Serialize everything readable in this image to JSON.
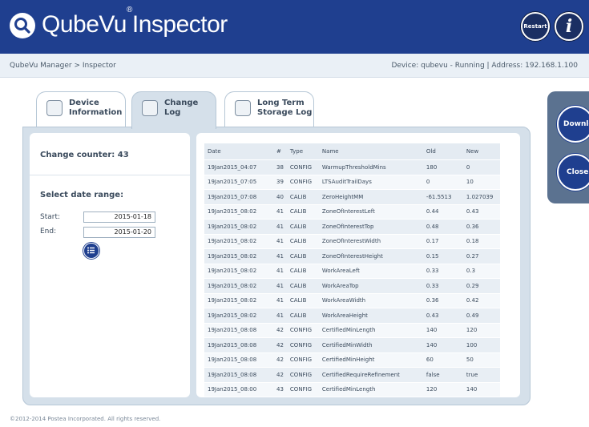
{
  "header": {
    "app_name": "QubeVu",
    "trademark": "®",
    "app_sub": "Inspector",
    "restart_label": "Restart",
    "info_label": "i"
  },
  "breadcrumb": "QubeVu Manager > Inspector",
  "status": "Device: qubevu - Running  |  Address: 192.168.1.100",
  "tabs": [
    {
      "label": "Device\nInformation",
      "active": false
    },
    {
      "label": "Change\nLog",
      "active": true
    },
    {
      "label": "Long Term\nStorage Log",
      "active": false
    }
  ],
  "left_panel": {
    "change_counter": "Change counter: 43",
    "select_range": "Select date range:",
    "start_label": "Start:",
    "start_value": "2015-01-18",
    "end_label": "End:",
    "end_value": "2015-01-20"
  },
  "table": {
    "columns": [
      "Date",
      "#",
      "Type",
      "Name",
      "Old",
      "New"
    ],
    "rows": [
      [
        "19Jan2015_04:07",
        "38",
        "CONFIG",
        "WarmupThresholdMins",
        "180",
        "0"
      ],
      [
        "19Jan2015_07:05",
        "39",
        "CONFIG",
        "LTSAuditTrailDays",
        "0",
        "10"
      ],
      [
        "19Jan2015_07:08",
        "40",
        "CALIB",
        "ZeroHeightMM",
        "-61.5513",
        "1.027039"
      ],
      [
        "19Jan2015_08:02",
        "41",
        "CALIB",
        "ZoneOfInterestLeft",
        "0.44",
        "0.43"
      ],
      [
        "19Jan2015_08:02",
        "41",
        "CALIB",
        "ZoneOfInterestTop",
        "0.48",
        "0.36"
      ],
      [
        "19Jan2015_08:02",
        "41",
        "CALIB",
        "ZoneOfInterestWidth",
        "0.17",
        "0.18"
      ],
      [
        "19Jan2015_08:02",
        "41",
        "CALIB",
        "ZoneOfInterestHeight",
        "0.15",
        "0.27"
      ],
      [
        "19Jan2015_08:02",
        "41",
        "CALIB",
        "WorkAreaLeft",
        "0.33",
        "0.3"
      ],
      [
        "19Jan2015_08:02",
        "41",
        "CALIB",
        "WorkAreaTop",
        "0.33",
        "0.29"
      ],
      [
        "19Jan2015_08:02",
        "41",
        "CALIB",
        "WorkAreaWidth",
        "0.36",
        "0.42"
      ],
      [
        "19Jan2015_08:02",
        "41",
        "CALIB",
        "WorkAreaHeight",
        "0.43",
        "0.49"
      ],
      [
        "19Jan2015_08:08",
        "42",
        "CONFIG",
        "CertifiedMinLength",
        "140",
        "120"
      ],
      [
        "19Jan2015_08:08",
        "42",
        "CONFIG",
        "CertifiedMinWidth",
        "140",
        "100"
      ],
      [
        "19Jan2015_08:08",
        "42",
        "CONFIG",
        "CertifiedMinHeight",
        "60",
        "50"
      ],
      [
        "19Jan2015_08:08",
        "42",
        "CONFIG",
        "CertifiedRequireRefinement",
        "false",
        "true"
      ],
      [
        "19Jan2015_08:00",
        "43",
        "CONFIG",
        "CertifiedMinLength",
        "120",
        "140"
      ]
    ]
  },
  "side": {
    "download_label": "Download",
    "close_label": "Close"
  },
  "footer": "©2012-2014 Postea Incorporated. All rights reserved.",
  "colors": {
    "header_bg": "#1f3f8f",
    "panel_bg": "#d5e0ea",
    "side_panel_bg": "#5b7290"
  },
  "icons": [
    "search-icon",
    "restart-icon",
    "info-icon",
    "device-icon",
    "log-icon",
    "storage-icon",
    "list-icon"
  ]
}
